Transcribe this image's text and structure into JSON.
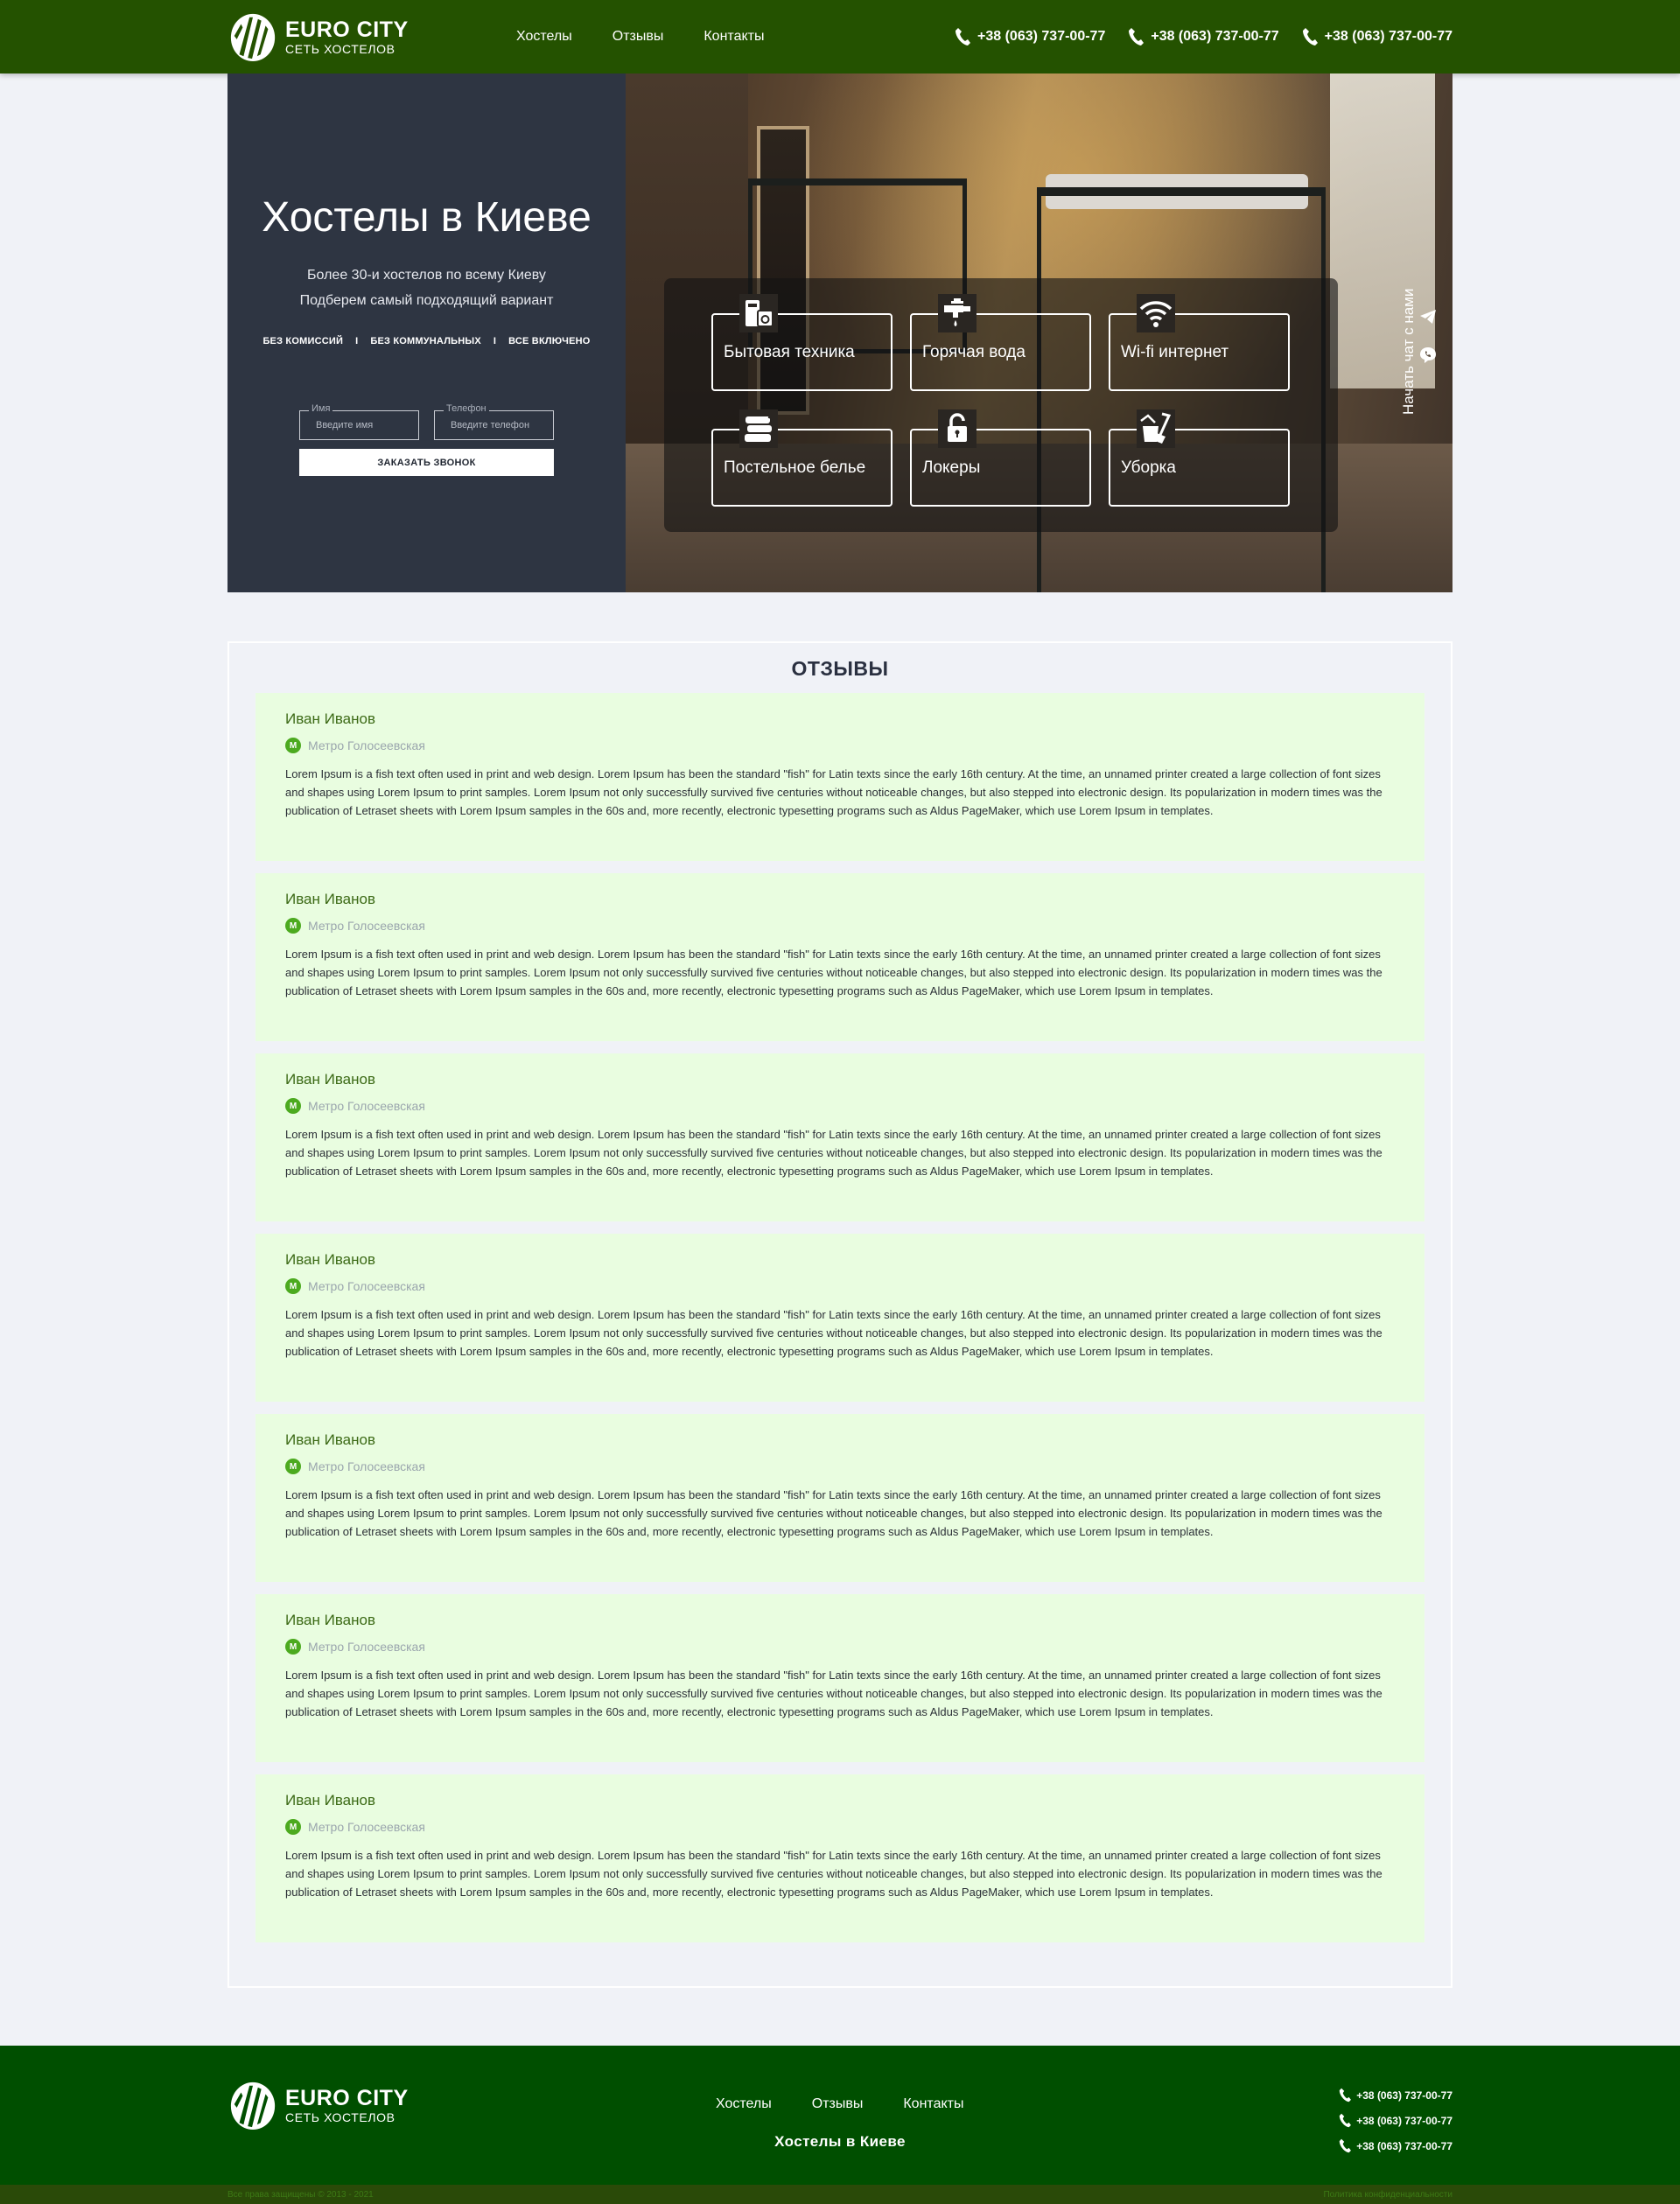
{
  "header": {
    "logo": {
      "brand": "EURO CITY",
      "subtitle": "СЕТЬ ХОСТЕЛОВ"
    },
    "nav": [
      "Хостелы",
      "Отзывы",
      "Контакты"
    ],
    "phones": [
      "+38 (063) 737-00-77",
      "+38 (063) 737-00-77",
      "+38 (063) 737-00-77"
    ]
  },
  "hero": {
    "title": "Хостелы в Киеве",
    "subtitle_lines": [
      "Более 30-и хостелов по всему Киеву",
      "Подберем самый подходящий вариант"
    ],
    "features": [
      "БЕЗ КОМИССИЙ",
      "БЕЗ КОММУНАЛЬНЫХ",
      "ВСЕ ВКЛЮЧЕНО"
    ],
    "form": {
      "name_label": "Имя",
      "name_placeholder": "Введите имя",
      "phone_label": "Телефон",
      "phone_placeholder": "Введите телефон",
      "submit": "ЗАКАЗАТЬ ЗВОНОК"
    },
    "amenities": [
      {
        "label": "Бытовая техника",
        "icon": "appliances-icon"
      },
      {
        "label": "Горячая вода",
        "icon": "faucet-icon"
      },
      {
        "label": "Wi-fi интернет",
        "icon": "wifi-icon"
      },
      {
        "label": "Постельное белье",
        "icon": "linen-icon"
      },
      {
        "label": "Локеры",
        "icon": "lock-icon"
      },
      {
        "label": "Уборка",
        "icon": "cleaning-icon"
      }
    ],
    "chat": {
      "label": "Начать чат с нами",
      "icons": [
        "telegram-icon",
        "viber-icon"
      ]
    }
  },
  "reviews": {
    "title": "ОТЗЫВЫ",
    "items": [
      {
        "name": "Иван Иванов",
        "metro_badge": "М",
        "metro": "Метро Голосеевская",
        "text": "Lorem Ipsum is a fish text often used in print and web design. Lorem Ipsum has been the standard \"fish\" for Latin texts since the early 16th century. At the time, an unnamed printer created a large collection of font sizes and shapes using Lorem Ipsum to print samples. Lorem Ipsum not only successfully survived five centuries without noticeable changes, but also stepped into electronic design. Its popularization in modern times was the publication of Letraset sheets with Lorem Ipsum samples in the 60s and, more recently, electronic typesetting programs such as Aldus PageMaker, which use Lorem Ipsum in templates."
      },
      {
        "name": "Иван Иванов",
        "metro_badge": "М",
        "metro": "Метро Голосеевская",
        "text": "Lorem Ipsum is a fish text often used in print and web design. Lorem Ipsum has been the standard \"fish\" for Latin texts since the early 16th century. At the time, an unnamed printer created a large collection of font sizes and shapes using Lorem Ipsum to print samples. Lorem Ipsum not only successfully survived five centuries without noticeable changes, but also stepped into electronic design. Its popularization in modern times was the publication of Letraset sheets with Lorem Ipsum samples in the 60s and, more recently, electronic typesetting programs such as Aldus PageMaker, which use Lorem Ipsum in templates."
      },
      {
        "name": "Иван Иванов",
        "metro_badge": "М",
        "metro": "Метро Голосеевская",
        "text": "Lorem Ipsum is a fish text often used in print and web design. Lorem Ipsum has been the standard \"fish\" for Latin texts since the early 16th century. At the time, an unnamed printer created a large collection of font sizes and shapes using Lorem Ipsum to print samples. Lorem Ipsum not only successfully survived five centuries without noticeable changes, but also stepped into electronic design. Its popularization in modern times was the publication of Letraset sheets with Lorem Ipsum samples in the 60s and, more recently, electronic typesetting programs such as Aldus PageMaker, which use Lorem Ipsum in templates."
      },
      {
        "name": "Иван Иванов",
        "metro_badge": "М",
        "metro": "Метро Голосеевская",
        "text": "Lorem Ipsum is a fish text often used in print and web design. Lorem Ipsum has been the standard \"fish\" for Latin texts since the early 16th century. At the time, an unnamed printer created a large collection of font sizes and shapes using Lorem Ipsum to print samples. Lorem Ipsum not only successfully survived five centuries without noticeable changes, but also stepped into electronic design. Its popularization in modern times was the publication of Letraset sheets with Lorem Ipsum samples in the 60s and, more recently, electronic typesetting programs such as Aldus PageMaker, which use Lorem Ipsum in templates."
      },
      {
        "name": "Иван Иванов",
        "metro_badge": "М",
        "metro": "Метро Голосеевская",
        "text": "Lorem Ipsum is a fish text often used in print and web design. Lorem Ipsum has been the standard \"fish\" for Latin texts since the early 16th century. At the time, an unnamed printer created a large collection of font sizes and shapes using Lorem Ipsum to print samples. Lorem Ipsum not only successfully survived five centuries without noticeable changes, but also stepped into electronic design. Its popularization in modern times was the publication of Letraset sheets with Lorem Ipsum samples in the 60s and, more recently, electronic typesetting programs such as Aldus PageMaker, which use Lorem Ipsum in templates."
      },
      {
        "name": "Иван Иванов",
        "metro_badge": "М",
        "metro": "Метро Голосеевская",
        "text": "Lorem Ipsum is a fish text often used in print and web design. Lorem Ipsum has been the standard \"fish\" for Latin texts since the early 16th century. At the time, an unnamed printer created a large collection of font sizes and shapes using Lorem Ipsum to print samples. Lorem Ipsum not only successfully survived five centuries without noticeable changes, but also stepped into electronic design. Its popularization in modern times was the publication of Letraset sheets with Lorem Ipsum samples in the 60s and, more recently, electronic typesetting programs such as Aldus PageMaker, which use Lorem Ipsum in templates."
      },
      {
        "name": "Иван Иванов",
        "metro_badge": "М",
        "metro": "Метро Голосеевская",
        "text": "Lorem Ipsum is a fish text often used in print and web design. Lorem Ipsum has been the standard \"fish\" for Latin texts since the early 16th century. At the time, an unnamed printer created a large collection of font sizes and shapes using Lorem Ipsum to print samples. Lorem Ipsum not only successfully survived five centuries without noticeable changes, but also stepped into electronic design. Its popularization in modern times was the publication of Letraset sheets with Lorem Ipsum samples in the 60s and, more recently, electronic typesetting programs such as Aldus PageMaker, which use Lorem Ipsum in templates."
      }
    ]
  },
  "footer": {
    "logo": {
      "brand": "EURO CITY",
      "subtitle": "СЕТЬ ХОСТЕЛОВ"
    },
    "nav": [
      "Хостелы",
      "Отзывы",
      "Контакты"
    ],
    "slogan": "Хостелы в Киеве",
    "phones": [
      "+38 (063) 737-00-77",
      "+38 (063) 737-00-77",
      "+38 (063) 737-00-77"
    ],
    "copyright": "Все права защищены © 2013 - 2021",
    "privacy": "Политика конфиденциальности"
  },
  "colors": {
    "header_green": "#245200",
    "footer_green": "#004f00",
    "hero_panel": "#2e3542",
    "review_bg": "#e9fde0",
    "review_name": "#3c6a16",
    "metro_green": "#4caa1f"
  }
}
